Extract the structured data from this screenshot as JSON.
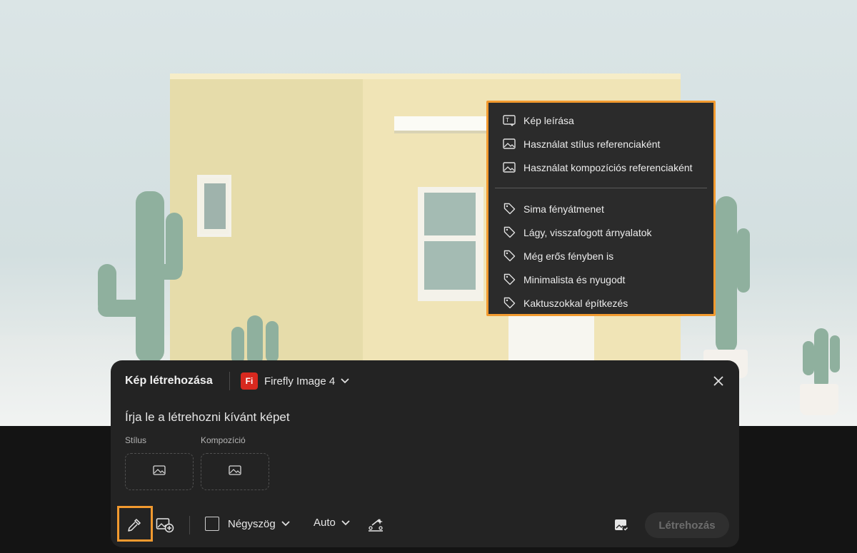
{
  "menu": {
    "items_top": [
      {
        "icon": "describe-image-icon",
        "label": "Kép leírása"
      },
      {
        "icon": "image-icon",
        "label": "Használat stílus referenciaként"
      },
      {
        "icon": "image-icon",
        "label": "Használat kompozíciós referenciaként"
      }
    ],
    "items_tags": [
      {
        "icon": "tag-icon",
        "label": "Sima fényátmenet"
      },
      {
        "icon": "tag-icon",
        "label": "Lágy, visszafogott árnyalatok"
      },
      {
        "icon": "tag-icon",
        "label": "Még erős fényben is"
      },
      {
        "icon": "tag-icon",
        "label": "Minimalista és nyugodt"
      },
      {
        "icon": "tag-icon",
        "label": "Kaktuszokkal építkezés"
      }
    ],
    "highlight_color": "#f29a2f"
  },
  "panel": {
    "title": "Kép létrehozása",
    "model_badge": "Fi",
    "model_name": "Firefly Image 4",
    "prompt_placeholder": "Írja le a létrehozni kívánt képet",
    "style_label": "Stílus",
    "composition_label": "Kompozíció",
    "shape_label": "Négyszög",
    "auto_label": "Auto",
    "generate_label": "Létrehozás",
    "brand_color": "#d8291f"
  }
}
